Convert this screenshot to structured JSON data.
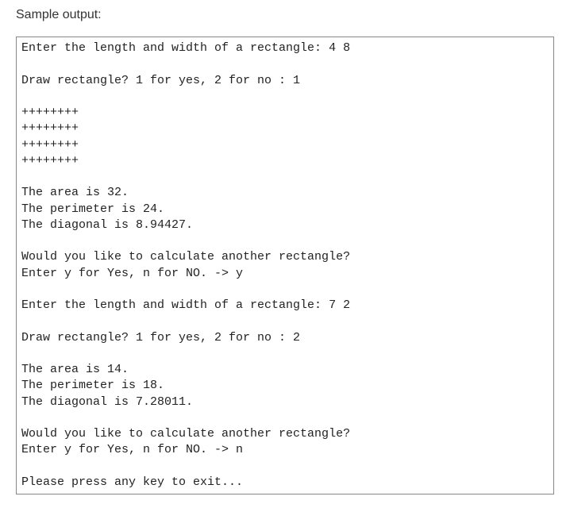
{
  "heading": "Sample output:",
  "console": "Enter the length and width of a rectangle: 4 8\n\nDraw rectangle? 1 for yes, 2 for no : 1\n\n++++++++\n++++++++\n++++++++\n++++++++\n\nThe area is 32.\nThe perimeter is 24.\nThe diagonal is 8.94427.\n\nWould you like to calculate another rectangle?\nEnter y for Yes, n for NO. -> y\n\nEnter the length and width of a rectangle: 7 2\n\nDraw rectangle? 1 for yes, 2 for no : 2\n\nThe area is 14.\nThe perimeter is 18.\nThe diagonal is 7.28011.\n\nWould you like to calculate another rectangle?\nEnter y for Yes, n for NO. -> n\n\nPlease press any key to exit..."
}
